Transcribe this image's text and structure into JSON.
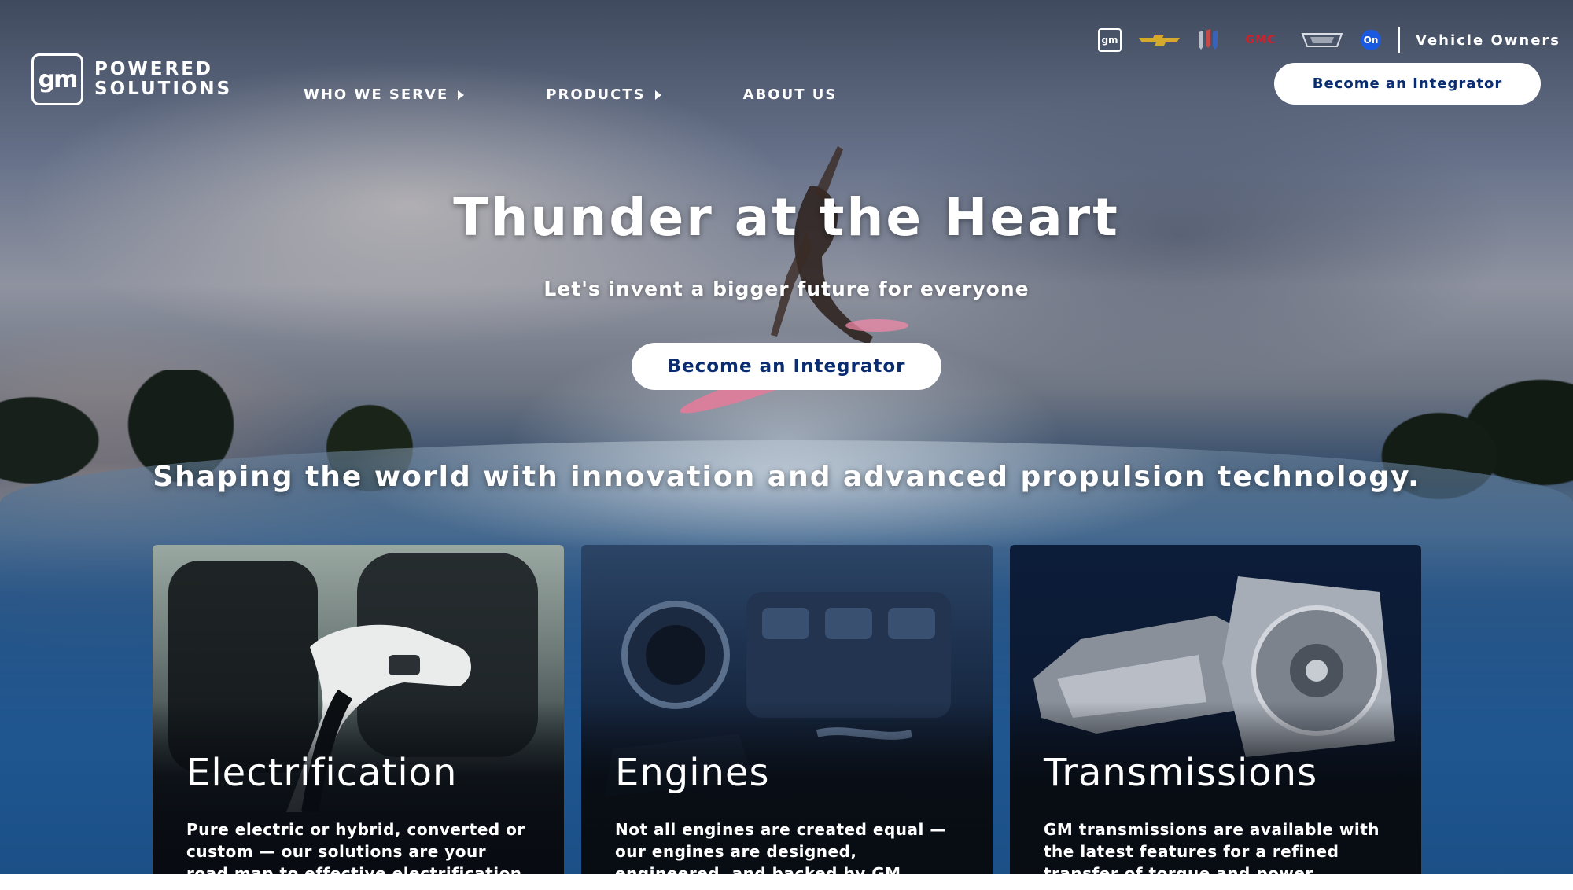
{
  "brand": {
    "logo_mark": "gm",
    "logo_line1": "POWERED",
    "logo_line2": "SOLUTIONS"
  },
  "nav": {
    "items": [
      {
        "label": "WHO WE SERVE",
        "has_submenu": true
      },
      {
        "label": "PRODUCTS",
        "has_submenu": true
      },
      {
        "label": "ABOUT US",
        "has_submenu": false
      }
    ]
  },
  "utility": {
    "brand_logos": [
      "gm-logo-icon",
      "chevrolet-logo-icon",
      "buick-logo-icon",
      "gmc-logo-icon",
      "cadillac-logo-icon",
      "onstar-logo-icon"
    ],
    "gm_mark": "gm",
    "gmc_text": "GMC",
    "onstar_text": "On",
    "vehicle_owners": "Vehicle Owners",
    "cta": "Become an Integrator"
  },
  "hero": {
    "title": "Thunder at the Heart",
    "subtitle": "Let's invent a bigger future for everyone",
    "cta": "Become an Integrator",
    "tagline": "Shaping the world with innovation and advanced propulsion technology."
  },
  "cards": [
    {
      "title": "Electrification",
      "text": "Pure electric or hybrid, converted or custom — our solutions are your road map to effective electrification."
    },
    {
      "title": "Engines",
      "text": "Not all engines are created equal — our engines are designed, engineered, and backed by GM."
    },
    {
      "title": "Transmissions",
      "text": "GM transmissions are available with the latest features for a refined transfer of torque and power."
    }
  ],
  "colors": {
    "button_text": "#0a2c70",
    "gmc_red": "#d0202a",
    "onstar_blue": "#1a5ae0"
  }
}
